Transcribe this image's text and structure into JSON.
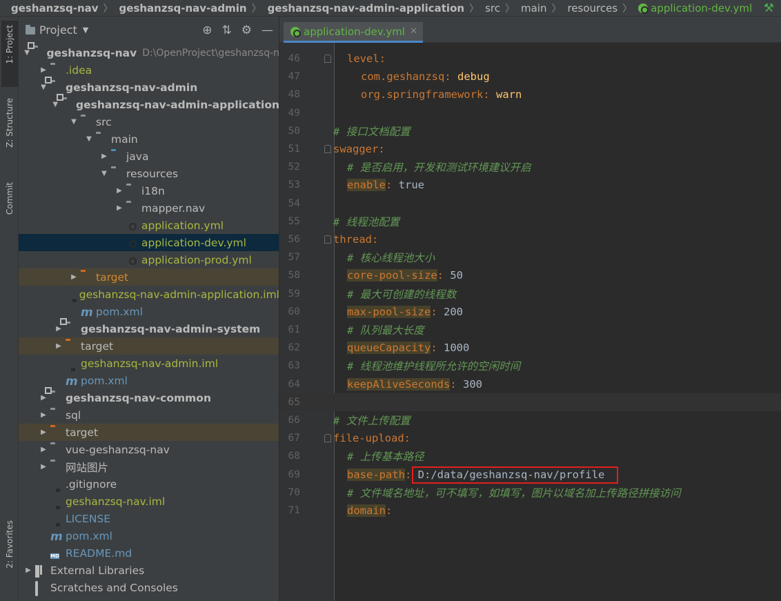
{
  "breadcrumb": [
    {
      "label": "geshanzsq-nav",
      "style": "bold"
    },
    {
      "label": "geshanzsq-nav-admin",
      "style": "bold"
    },
    {
      "label": "geshanzsq-nav-admin-application",
      "style": "bold"
    },
    {
      "label": "src",
      "style": "plain"
    },
    {
      "label": "main",
      "style": "plain"
    },
    {
      "label": "resources",
      "style": "plain"
    },
    {
      "label": "application-dev.yml",
      "style": "file"
    }
  ],
  "tool_strip": {
    "project_tab": "1: Project",
    "structure_tab": "Z: Structure",
    "commit_tab": "Commit",
    "favorites_tab": "2: Favorites"
  },
  "project_panel": {
    "title": "Project",
    "tree": [
      {
        "label": "geshanzsq-nav",
        "path": "D:\\OpenProject\\geshanzsq-n",
        "indent": 0,
        "arrow": "down",
        "icon": "folder-module",
        "style": "bold"
      },
      {
        "label": ".idea",
        "indent": 1,
        "arrow": "right",
        "icon": "folder",
        "style": "olive"
      },
      {
        "label": "geshanzsq-nav-admin",
        "indent": 1,
        "arrow": "down",
        "icon": "folder-module",
        "style": "bold"
      },
      {
        "label": "geshanzsq-nav-admin-application",
        "indent": 2,
        "arrow": "down",
        "icon": "folder-module",
        "style": "bold"
      },
      {
        "label": "src",
        "indent": 3,
        "arrow": "down",
        "icon": "folder",
        "style": "normal"
      },
      {
        "label": "main",
        "indent": 4,
        "arrow": "down",
        "icon": "folder",
        "style": "normal"
      },
      {
        "label": "java",
        "indent": 5,
        "arrow": "right",
        "icon": "folder-blue",
        "style": "normal"
      },
      {
        "label": "resources",
        "indent": 5,
        "arrow": "down",
        "icon": "folder-res",
        "style": "normal"
      },
      {
        "label": "i18n",
        "indent": 6,
        "arrow": "right",
        "icon": "folder",
        "style": "normal"
      },
      {
        "label": "mapper.nav",
        "indent": 6,
        "arrow": "right",
        "icon": "folder",
        "style": "normal"
      },
      {
        "label": "application.yml",
        "indent": 6,
        "arrow": "",
        "icon": "yml",
        "style": "olive"
      },
      {
        "label": "application-dev.yml",
        "indent": 6,
        "arrow": "",
        "icon": "yml",
        "style": "olive",
        "selected": true
      },
      {
        "label": "application-prod.yml",
        "indent": 6,
        "arrow": "",
        "icon": "yml",
        "style": "olive"
      },
      {
        "label": "target",
        "indent": 3,
        "arrow": "right",
        "icon": "folder-orange",
        "style": "orange",
        "excluded": true
      },
      {
        "label": "geshanzsq-nav-admin-application.iml",
        "indent": 3,
        "arrow": "",
        "icon": "file",
        "style": "olive"
      },
      {
        "label": "pom.xml",
        "indent": 3,
        "arrow": "",
        "icon": "maven",
        "style": "blue"
      },
      {
        "label": "geshanzsq-nav-admin-system",
        "indent": 2,
        "arrow": "right",
        "icon": "folder-module",
        "style": "bold"
      },
      {
        "label": "target",
        "indent": 2,
        "arrow": "right",
        "icon": "folder-orange",
        "style": "normal",
        "excluded": true
      },
      {
        "label": "geshanzsq-nav-admin.iml",
        "indent": 2,
        "arrow": "",
        "icon": "file",
        "style": "olive"
      },
      {
        "label": "pom.xml",
        "indent": 2,
        "arrow": "",
        "icon": "maven",
        "style": "blue"
      },
      {
        "label": "geshanzsq-nav-common",
        "indent": 1,
        "arrow": "right",
        "icon": "folder-module",
        "style": "bold"
      },
      {
        "label": "sql",
        "indent": 1,
        "arrow": "right",
        "icon": "folder",
        "style": "normal"
      },
      {
        "label": "target",
        "indent": 1,
        "arrow": "right",
        "icon": "folder-orange",
        "style": "normal",
        "excluded": true
      },
      {
        "label": "vue-geshanzsq-nav",
        "indent": 1,
        "arrow": "right",
        "icon": "folder",
        "style": "normal"
      },
      {
        "label": "网站图片",
        "indent": 1,
        "arrow": "right",
        "icon": "folder",
        "style": "normal"
      },
      {
        "label": ".gitignore",
        "indent": 1,
        "arrow": "",
        "icon": "file",
        "style": "normal"
      },
      {
        "label": "geshanzsq-nav.iml",
        "indent": 1,
        "arrow": "",
        "icon": "file",
        "style": "olive"
      },
      {
        "label": "LICENSE",
        "indent": 1,
        "arrow": "",
        "icon": "text",
        "style": "blue"
      },
      {
        "label": "pom.xml",
        "indent": 1,
        "arrow": "",
        "icon": "maven",
        "style": "blue"
      },
      {
        "label": "README.md",
        "indent": 1,
        "arrow": "",
        "icon": "md",
        "style": "blue"
      },
      {
        "label": "External Libraries",
        "indent": 0,
        "arrow": "right",
        "icon": "lib",
        "style": "normal"
      },
      {
        "label": "Scratches and Consoles",
        "indent": 0,
        "arrow": "",
        "icon": "scratch",
        "style": "normal"
      }
    ]
  },
  "editor": {
    "active_tab": "application-dev.yml",
    "lines": [
      {
        "n": "46",
        "indent": 1,
        "parts": [
          {
            "t": "level",
            "c": "key"
          },
          {
            "t": ":",
            "c": "colon"
          }
        ]
      },
      {
        "n": "47",
        "indent": 2,
        "parts": [
          {
            "t": "com.geshanzsq",
            "c": "key"
          },
          {
            "t": ": ",
            "c": "colon"
          },
          {
            "t": "debug",
            "c": "str"
          }
        ]
      },
      {
        "n": "48",
        "indent": 2,
        "parts": [
          {
            "t": "org.springframework",
            "c": "key"
          },
          {
            "t": ": ",
            "c": "colon"
          },
          {
            "t": "warn",
            "c": "str"
          }
        ]
      },
      {
        "n": "49",
        "indent": 0,
        "parts": []
      },
      {
        "n": "50",
        "indent": 0,
        "parts": [
          {
            "t": "# 接口文档配置",
            "c": "comment"
          }
        ]
      },
      {
        "n": "51",
        "indent": 0,
        "parts": [
          {
            "t": "swagger",
            "c": "key"
          },
          {
            "t": ":",
            "c": "colon"
          }
        ]
      },
      {
        "n": "52",
        "indent": 1,
        "parts": [
          {
            "t": "# 是否启用，开发和测试环境建议开启",
            "c": "comment"
          }
        ]
      },
      {
        "n": "53",
        "indent": 1,
        "parts": [
          {
            "t": "enable",
            "c": "hi"
          },
          {
            "t": ": ",
            "c": "colon"
          },
          {
            "t": "true",
            "c": "plain"
          }
        ]
      },
      {
        "n": "54",
        "indent": 0,
        "parts": []
      },
      {
        "n": "55",
        "indent": 0,
        "parts": [
          {
            "t": "# 线程池配置",
            "c": "comment"
          }
        ]
      },
      {
        "n": "56",
        "indent": 0,
        "parts": [
          {
            "t": "thread",
            "c": "key"
          },
          {
            "t": ":",
            "c": "colon"
          }
        ]
      },
      {
        "n": "57",
        "indent": 1,
        "parts": [
          {
            "t": "# 核心线程池大小",
            "c": "comment"
          }
        ]
      },
      {
        "n": "58",
        "indent": 1,
        "parts": [
          {
            "t": "core-pool-size",
            "c": "hi"
          },
          {
            "t": ": ",
            "c": "colon"
          },
          {
            "t": "50",
            "c": "plain"
          }
        ]
      },
      {
        "n": "59",
        "indent": 1,
        "parts": [
          {
            "t": "# 最大可创建的线程数",
            "c": "comment"
          }
        ]
      },
      {
        "n": "60",
        "indent": 1,
        "parts": [
          {
            "t": "max-pool-size",
            "c": "hi"
          },
          {
            "t": ": ",
            "c": "colon"
          },
          {
            "t": "200",
            "c": "plain"
          }
        ]
      },
      {
        "n": "61",
        "indent": 1,
        "parts": [
          {
            "t": "# 队列最大长度",
            "c": "comment"
          }
        ]
      },
      {
        "n": "62",
        "indent": 1,
        "parts": [
          {
            "t": "queueCapacity",
            "c": "hi"
          },
          {
            "t": ": ",
            "c": "colon"
          },
          {
            "t": "1000",
            "c": "plain"
          }
        ]
      },
      {
        "n": "63",
        "indent": 1,
        "parts": [
          {
            "t": "# 线程池维护线程所允许的空闲时间",
            "c": "comment"
          }
        ]
      },
      {
        "n": "64",
        "indent": 1,
        "parts": [
          {
            "t": "keepAliveSeconds",
            "c": "hi"
          },
          {
            "t": ": ",
            "c": "colon"
          },
          {
            "t": "300",
            "c": "plain"
          }
        ]
      },
      {
        "n": "65",
        "indent": 0,
        "parts": [],
        "current": true
      },
      {
        "n": "66",
        "indent": 0,
        "parts": [
          {
            "t": "# 文件上传配置",
            "c": "comment"
          }
        ]
      },
      {
        "n": "67",
        "indent": 0,
        "parts": [
          {
            "t": "file-upload",
            "c": "key"
          },
          {
            "t": ":",
            "c": "colon"
          }
        ]
      },
      {
        "n": "68",
        "indent": 1,
        "parts": [
          {
            "t": "# 上传基本路径",
            "c": "comment"
          }
        ]
      },
      {
        "n": "69",
        "indent": 1,
        "parts": [
          {
            "t": "base-path",
            "c": "hi"
          },
          {
            "t": ": ",
            "c": "colon"
          },
          {
            "t": "D:/data/geshanzsq-nav/profile",
            "c": "plain"
          }
        ],
        "boxed": true
      },
      {
        "n": "70",
        "indent": 1,
        "parts": [
          {
            "t": "# 文件域名地址，可不填写，如填写，图片以域名加上传路径拼接访问",
            "c": "comment"
          }
        ]
      },
      {
        "n": "71",
        "indent": 1,
        "parts": [
          {
            "t": "domain",
            "c": "hi"
          },
          {
            "t": ":",
            "c": "colon"
          }
        ]
      }
    ]
  },
  "colors": {
    "accent": "#4a88c7",
    "highlight_box": "#e0201a",
    "selected_row": "#0d293e"
  }
}
